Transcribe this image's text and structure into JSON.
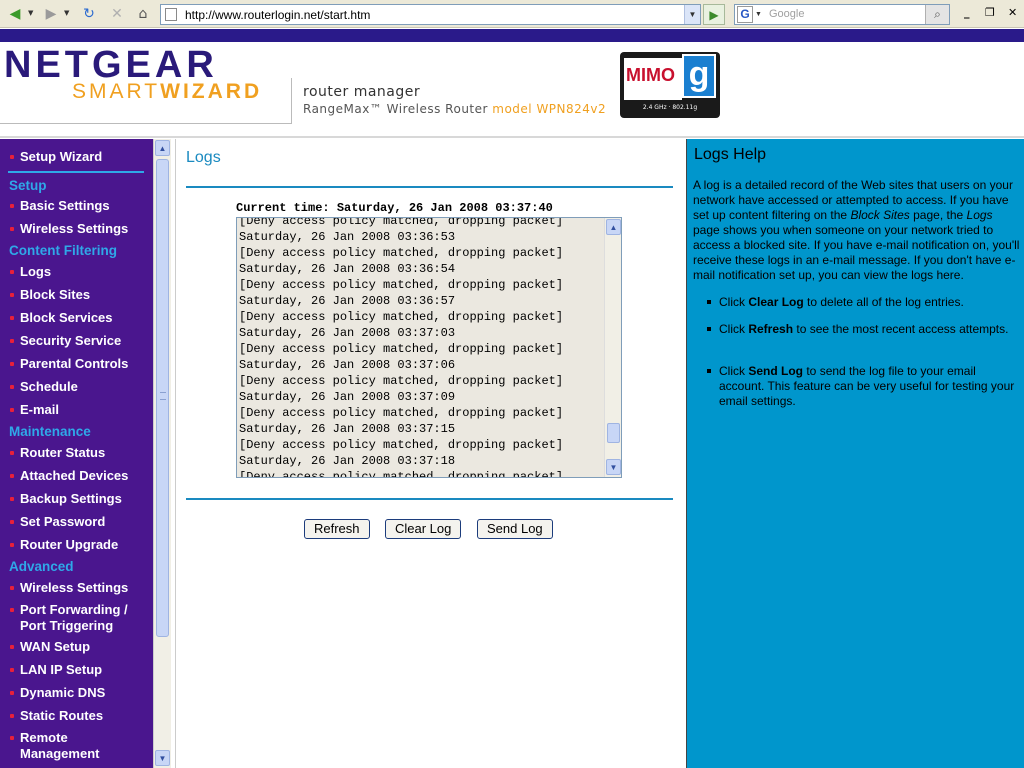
{
  "browser": {
    "url": "http://www.routerlogin.net/start.htm",
    "search_placeholder": "Google",
    "search_logo": "G"
  },
  "header": {
    "brand": "NETGEAR",
    "smart": "SMART",
    "wizard": "WIZARD",
    "router_manager": "router manager",
    "product": "RangeMax™ Wireless Router ",
    "model": "model WPN824v2",
    "badge_mimo": "MIMO",
    "badge_g": "g",
    "badge_freq": "2.4 GHz · 802.11g"
  },
  "nav": {
    "setup_wizard": "Setup Wizard",
    "sec_setup": "Setup",
    "basic_settings": "Basic Settings",
    "wireless_settings": "Wireless Settings",
    "sec_content": "Content Filtering",
    "logs": "Logs",
    "block_sites": "Block Sites",
    "block_services": "Block Services",
    "security_service": "Security Service",
    "parental_controls": "Parental Controls",
    "schedule": "Schedule",
    "email": "E-mail",
    "sec_maintenance": "Maintenance",
    "router_status": "Router Status",
    "attached_devices": "Attached Devices",
    "backup_settings": "Backup Settings",
    "set_password": "Set Password",
    "router_upgrade": "Router Upgrade",
    "sec_advanced": "Advanced",
    "adv_wireless_settings": "Wireless Settings",
    "port_forwarding_1": "Port Forwarding /",
    "port_forwarding_2": "Port Triggering",
    "wan_setup": "WAN Setup",
    "lan_ip_setup": "LAN IP Setup",
    "dynamic_dns": "Dynamic DNS",
    "static_routes": "Static Routes",
    "remote_mgmt_1": "Remote",
    "remote_mgmt_2": "Management"
  },
  "main": {
    "title": "Logs",
    "current_time_label": "Current time: Saturday, 26 Jan 2008 03:37:40",
    "log_lines": [
      "[Deny access policy matched, dropping packet]",
      "Saturday, 26 Jan 2008 03:36:53",
      "[Deny access policy matched, dropping packet]",
      "Saturday, 26 Jan 2008 03:36:54",
      "[Deny access policy matched, dropping packet]",
      "Saturday, 26 Jan 2008 03:36:57",
      "[Deny access policy matched, dropping packet]",
      "Saturday, 26 Jan 2008 03:37:03",
      "[Deny access policy matched, dropping packet]",
      "Saturday, 26 Jan 2008 03:37:06",
      "[Deny access policy matched, dropping packet]",
      "Saturday, 26 Jan 2008 03:37:09",
      "[Deny access policy matched, dropping packet]",
      "Saturday, 26 Jan 2008 03:37:15",
      "[Deny access policy matched, dropping packet]",
      "Saturday, 26 Jan 2008 03:37:18",
      "[Deny access policy matched, dropping packet]"
    ],
    "buttons": {
      "refresh": "Refresh",
      "clear_log": "Clear Log",
      "send_log": "Send Log"
    }
  },
  "help": {
    "title": "Logs Help",
    "p1_a": "A log is a detailed record of the Web sites that users on your network have accessed or attempted to access. If you have set up content filtering on the ",
    "p1_block_sites": "Block Sites",
    "p1_b": " page, the ",
    "p1_logs": "Logs",
    "p1_c": " page shows you when someone on your network tried to access a blocked site. If you have e-mail notification on, you'll receive these logs in an e-mail message. If you don't have e-mail notification set up, you can view the logs here.",
    "b1_pre": "Click ",
    "b1_bold": "Clear Log",
    "b1_post": " to delete all of the log entries.",
    "b2_pre": "Click ",
    "b2_bold": "Refresh",
    "b2_post": " to see the most recent access attempts.",
    "b3_pre": "Click ",
    "b3_bold": "Send Log",
    "b3_post": " to send the log file to your email account. This feature can be very useful for testing your email settings."
  },
  "colors": {
    "nav_bg": "#4a168e",
    "nav_section": "#2fa8e8",
    "accent_blue": "#1a8ac0",
    "help_bg": "#0096cc",
    "bullet_red": "#e8203a"
  }
}
